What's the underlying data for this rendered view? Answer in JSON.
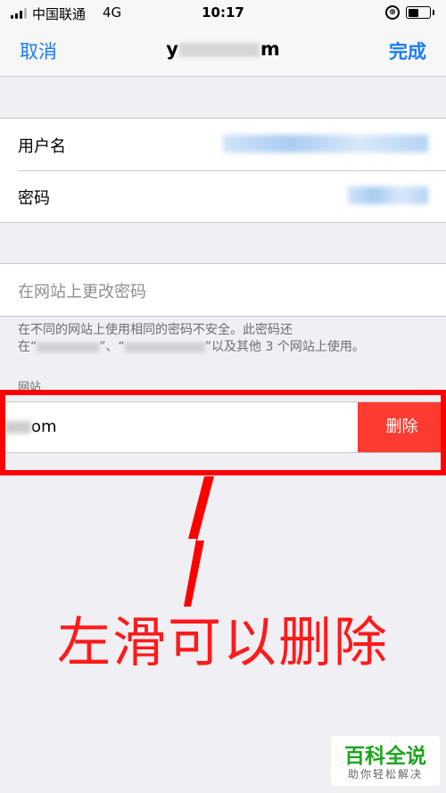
{
  "status_bar": {
    "carrier": "中国联通",
    "network": "4G",
    "time": "10:17",
    "rotation_symbol": "⊕",
    "battery_level": 0.55
  },
  "nav": {
    "cancel": "取消",
    "title_first": "y",
    "title_last": "m",
    "done": "完成"
  },
  "credentials": {
    "username_label": "用户名",
    "password_label": "密码"
  },
  "change_password": {
    "label": "在网站上更改密码"
  },
  "security_note": {
    "line1": "在不同的网站上使用相同的密码不安全。此密码还",
    "line2_prefix": "在“",
    "line2_mid": "”、“",
    "line2_suffix": "”以及其他 3 个网站上使用。"
  },
  "websites": {
    "header": "网站",
    "item_suffix": "om",
    "delete_label": "删除"
  },
  "annotation": {
    "text": "左滑可以删除"
  },
  "watermark": {
    "title": "百科全说",
    "subtitle": "助你轻松解决"
  },
  "colors": {
    "accent": "#1a7cf6",
    "delete": "#fd3b30",
    "annotation": "#ff0000",
    "watermark": "#1fa41f"
  }
}
